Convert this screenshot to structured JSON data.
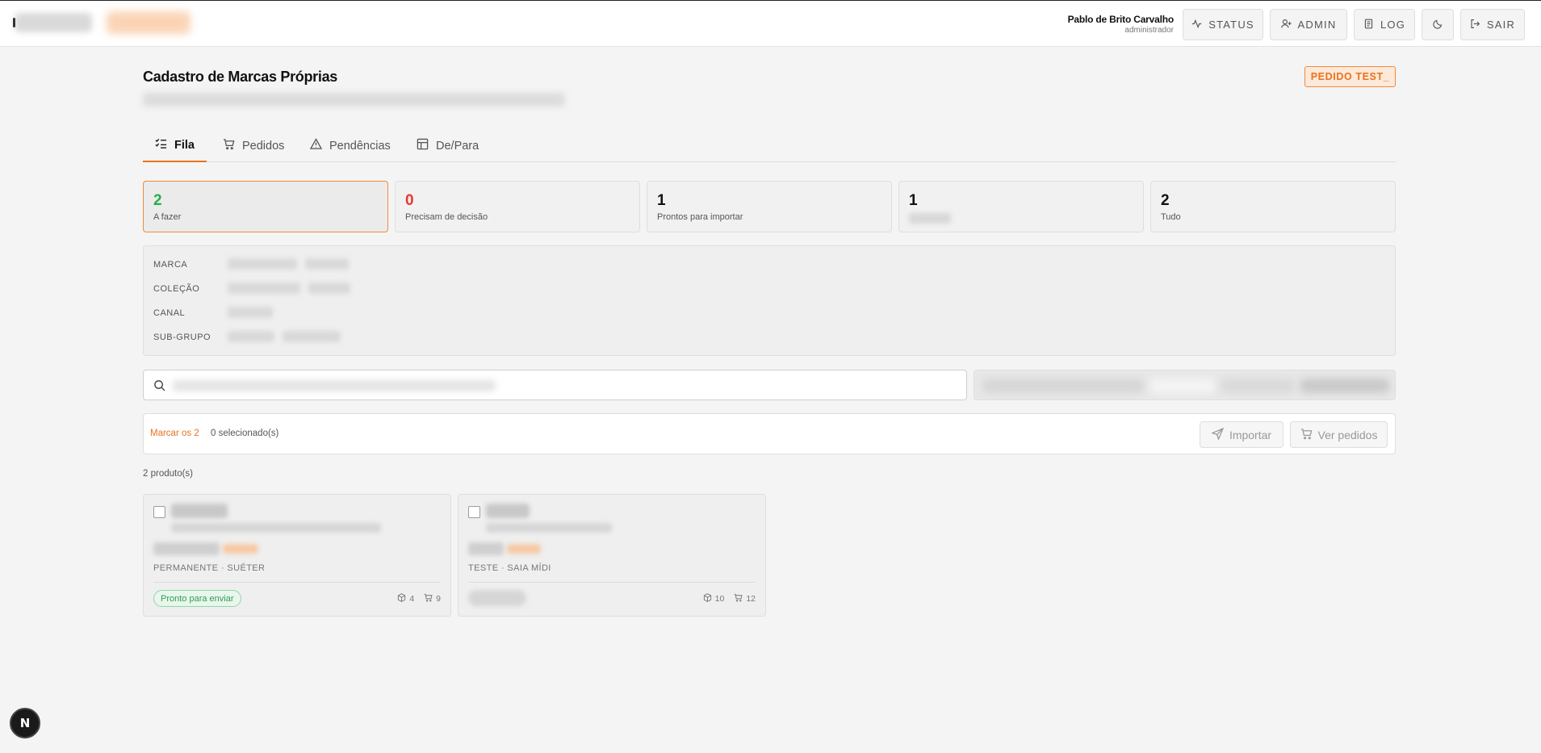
{
  "header": {
    "user_name": "Pablo de Brito Carvalho",
    "user_role": "administrador",
    "buttons": {
      "status": "STATUS",
      "admin": "ADMIN",
      "log": "LOG",
      "logout": "SAIR"
    }
  },
  "page": {
    "title": "Cadastro de Marcas Próprias",
    "order_badge": "PEDIDO TEST_"
  },
  "tabs": [
    {
      "label": "Fila",
      "icon": "checklist-icon",
      "active": true
    },
    {
      "label": "Pedidos",
      "icon": "cart-icon"
    },
    {
      "label": "Pendências",
      "icon": "warning-icon"
    },
    {
      "label": "De/Para",
      "icon": "table-icon"
    }
  ],
  "stats": [
    {
      "value": "2",
      "label": "A fazer",
      "color": "#22b14c"
    },
    {
      "value": "0",
      "label": "Precisam de decisão",
      "color": "#e53935"
    },
    {
      "value": "1",
      "label": "Prontos para importar",
      "color": "#111111"
    },
    {
      "value": "1",
      "label": "",
      "color": "#111111"
    },
    {
      "value": "2",
      "label": "Tudo",
      "color": "#111111"
    }
  ],
  "filters": {
    "marca": "MARCA",
    "colecao": "COLEÇÃO",
    "canal": "CANAL",
    "subgrupo": "SUB-GRUPO"
  },
  "actions": {
    "mark_all": "Marcar os 2",
    "selected": "0 selecionado(s)",
    "import": "Importar",
    "view_orders": "Ver pedidos"
  },
  "products_count": "2 produto(s)",
  "products": [
    {
      "category": "PERMANENTE · SUÉTER",
      "status": "Pronto para enviar",
      "boxes": "4",
      "cart": "9"
    },
    {
      "category": "TESTE · SAIA MÍDI",
      "status": "",
      "boxes": "10",
      "cart": "12"
    }
  ],
  "colors": {
    "accent": "#e8731f",
    "success": "#22b14c",
    "danger": "#e53935"
  },
  "dev_badge": "N"
}
